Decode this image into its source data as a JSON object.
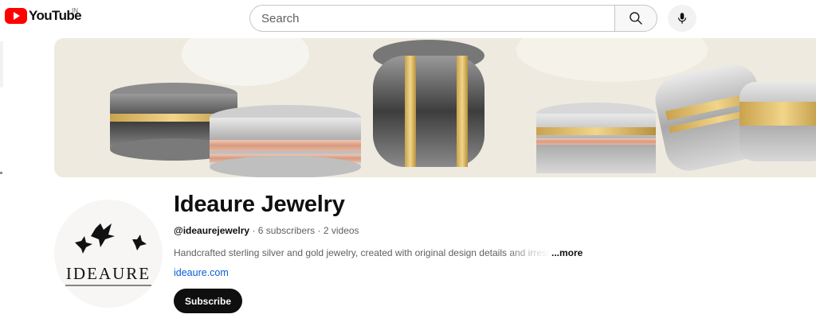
{
  "header": {
    "logo_text": "YouTube",
    "region_code": "IN",
    "search_placeholder": "Search"
  },
  "channel": {
    "name": "Ideaure Jewelry",
    "handle": "@ideaurejewelry",
    "subscribers": "6 subscribers",
    "videos": "2 videos",
    "separator": "·",
    "description": "Handcrafted sterling silver and gold jewelry, created with original design details and irresistible",
    "more_label": "...more",
    "link": "ideaure.com",
    "subscribe_label": "Subscribe",
    "avatar_wordmark": "IDEAURE"
  },
  "colors": {
    "brand_red": "#ff0000",
    "link_blue": "#065fd4",
    "subscribe_bg": "#0f0f0f"
  }
}
